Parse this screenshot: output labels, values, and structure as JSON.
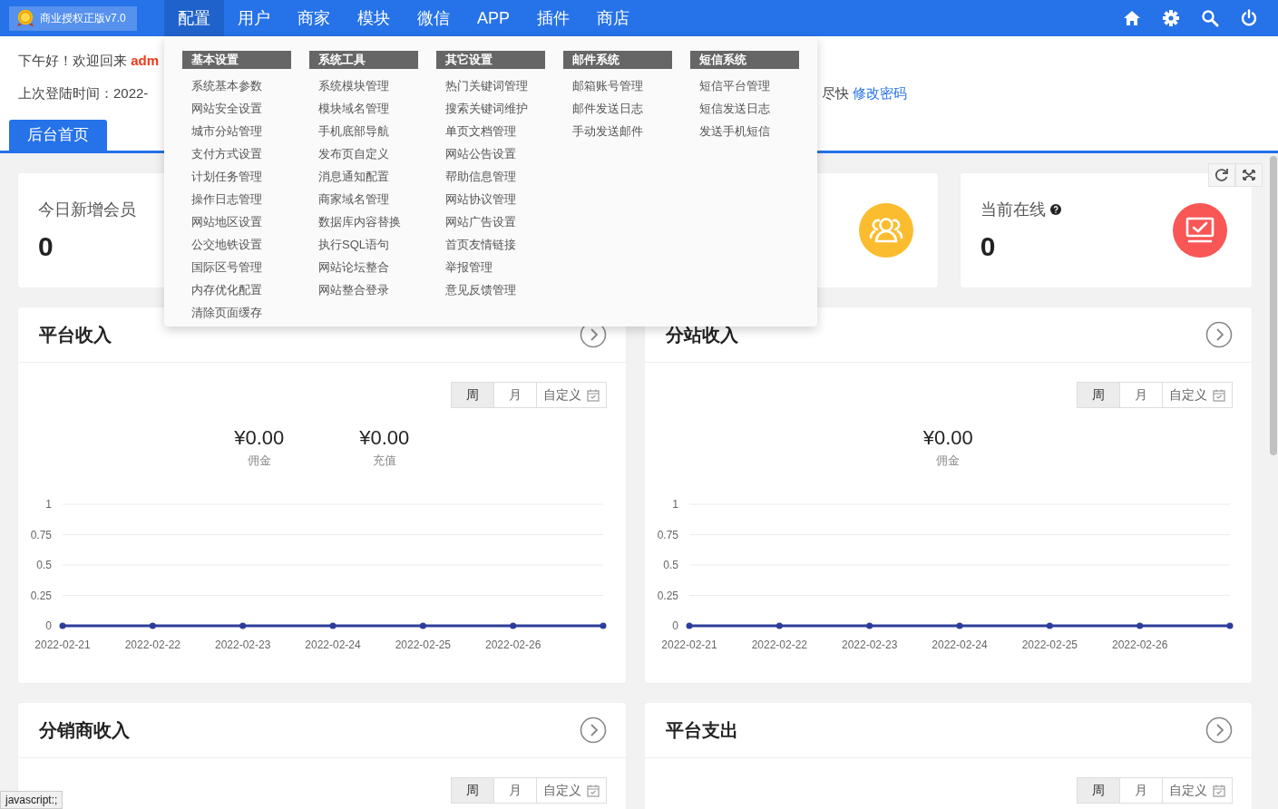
{
  "topbar": {
    "brand": "商业授权正版v7.0",
    "nav": [
      {
        "label": "配置",
        "selected": true
      },
      {
        "label": "用户",
        "selected": false
      },
      {
        "label": "商家",
        "selected": false
      },
      {
        "label": "模块",
        "selected": false
      },
      {
        "label": "微信",
        "selected": false
      },
      {
        "label": "APP",
        "selected": false
      },
      {
        "label": "插件",
        "selected": false
      },
      {
        "label": "商店",
        "selected": false
      }
    ]
  },
  "dropdown": {
    "columns": [
      {
        "title": "基本设置",
        "items": [
          "系统基本参数",
          "网站安全设置",
          "城市分站管理",
          "支付方式设置",
          "计划任务管理",
          "操作日志管理",
          "网站地区设置",
          "公交地铁设置",
          "国际区号管理",
          "内存优化配置",
          "清除页面缓存"
        ]
      },
      {
        "title": "系统工具",
        "items": [
          "系统模块管理",
          "模块域名管理",
          "手机底部导航",
          "发布页自定义",
          "消息通知配置",
          "商家域名管理",
          "数据库内容替换",
          "执行SQL语句",
          "网站论坛整合",
          "网站整合登录"
        ]
      },
      {
        "title": "其它设置",
        "items": [
          "热门关键词管理",
          "搜索关键词维护",
          "单页文档管理",
          "网站公告设置",
          "帮助信息管理",
          "网站协议管理",
          "网站广告设置",
          "首页友情链接",
          "举报管理",
          "意见反馈管理"
        ]
      },
      {
        "title": "邮件系统",
        "items": [
          "邮箱账号管理",
          "邮件发送日志",
          "手动发送邮件"
        ]
      },
      {
        "title": "短信系统",
        "items": [
          "短信平台管理",
          "短信发送日志",
          "发送手机短信"
        ]
      }
    ]
  },
  "welcome": {
    "greeting": "下午好！欢迎回来",
    "user": "adm",
    "last_login": "上次登陆时间：2022-",
    "notice": "尽快",
    "link": "修改密码"
  },
  "tabs": [
    {
      "label": "后台首页",
      "selected": true
    }
  ],
  "stat_cards": [
    {
      "kind": "text",
      "label": "今日新增会员",
      "value": "0"
    },
    {
      "kind": "icon",
      "color": "#fbbd2f"
    },
    {
      "kind": "full",
      "label": "当前在线",
      "help": true,
      "value": "0",
      "color": "#f95656"
    }
  ],
  "panels": [
    {
      "title": "平台收入",
      "ranges": [
        {
          "label": "周",
          "selected": true
        },
        {
          "label": "月",
          "selected": false
        },
        {
          "label": "自定义",
          "selected": false
        }
      ],
      "stats": [
        {
          "value": "¥0.00",
          "label": "佣金"
        },
        {
          "value": "¥0.00",
          "label": "充值"
        }
      ],
      "chart_data": {
        "type": "line",
        "categories": [
          "2022-02-21",
          "2022-02-22",
          "2022-02-23",
          "2022-02-24",
          "2022-02-25",
          "2022-02-26",
          null
        ],
        "ylim": [
          0,
          1
        ],
        "yticks": [
          0,
          0.25,
          0.5,
          0.75,
          1
        ],
        "grid": true,
        "series": [
          {
            "color": "#2e3d99",
            "marker": true,
            "values": [
              0,
              0,
              0,
              0,
              0,
              0,
              0
            ]
          }
        ]
      }
    },
    {
      "title": "分站收入",
      "ranges": [
        {
          "label": "周",
          "selected": true
        },
        {
          "label": "月",
          "selected": false
        },
        {
          "label": "自定义",
          "selected": false
        }
      ],
      "stats": [
        {
          "value": "¥0.00",
          "label": "佣金"
        }
      ],
      "chart_data": {
        "type": "line",
        "categories": [
          "2022-02-21",
          "2022-02-22",
          "2022-02-23",
          "2022-02-24",
          "2022-02-25",
          "2022-02-26",
          null
        ],
        "ylim": [
          0,
          1
        ],
        "yticks": [
          0,
          0.25,
          0.5,
          0.75,
          1
        ],
        "grid": true,
        "series": [
          {
            "color": "#2e3d99",
            "marker": true,
            "values": [
              0,
              0,
              0,
              0,
              0,
              0,
              0
            ]
          }
        ]
      }
    },
    {
      "title": "分销商收入",
      "ranges": [
        {
          "label": "周",
          "selected": true
        },
        {
          "label": "月",
          "selected": false
        },
        {
          "label": "自定义",
          "selected": false
        }
      ]
    },
    {
      "title": "平台支出",
      "ranges": [
        {
          "label": "周",
          "selected": true
        },
        {
          "label": "月",
          "selected": false
        },
        {
          "label": "自定义",
          "selected": false
        }
      ]
    }
  ],
  "status_bar": "javascript:;"
}
